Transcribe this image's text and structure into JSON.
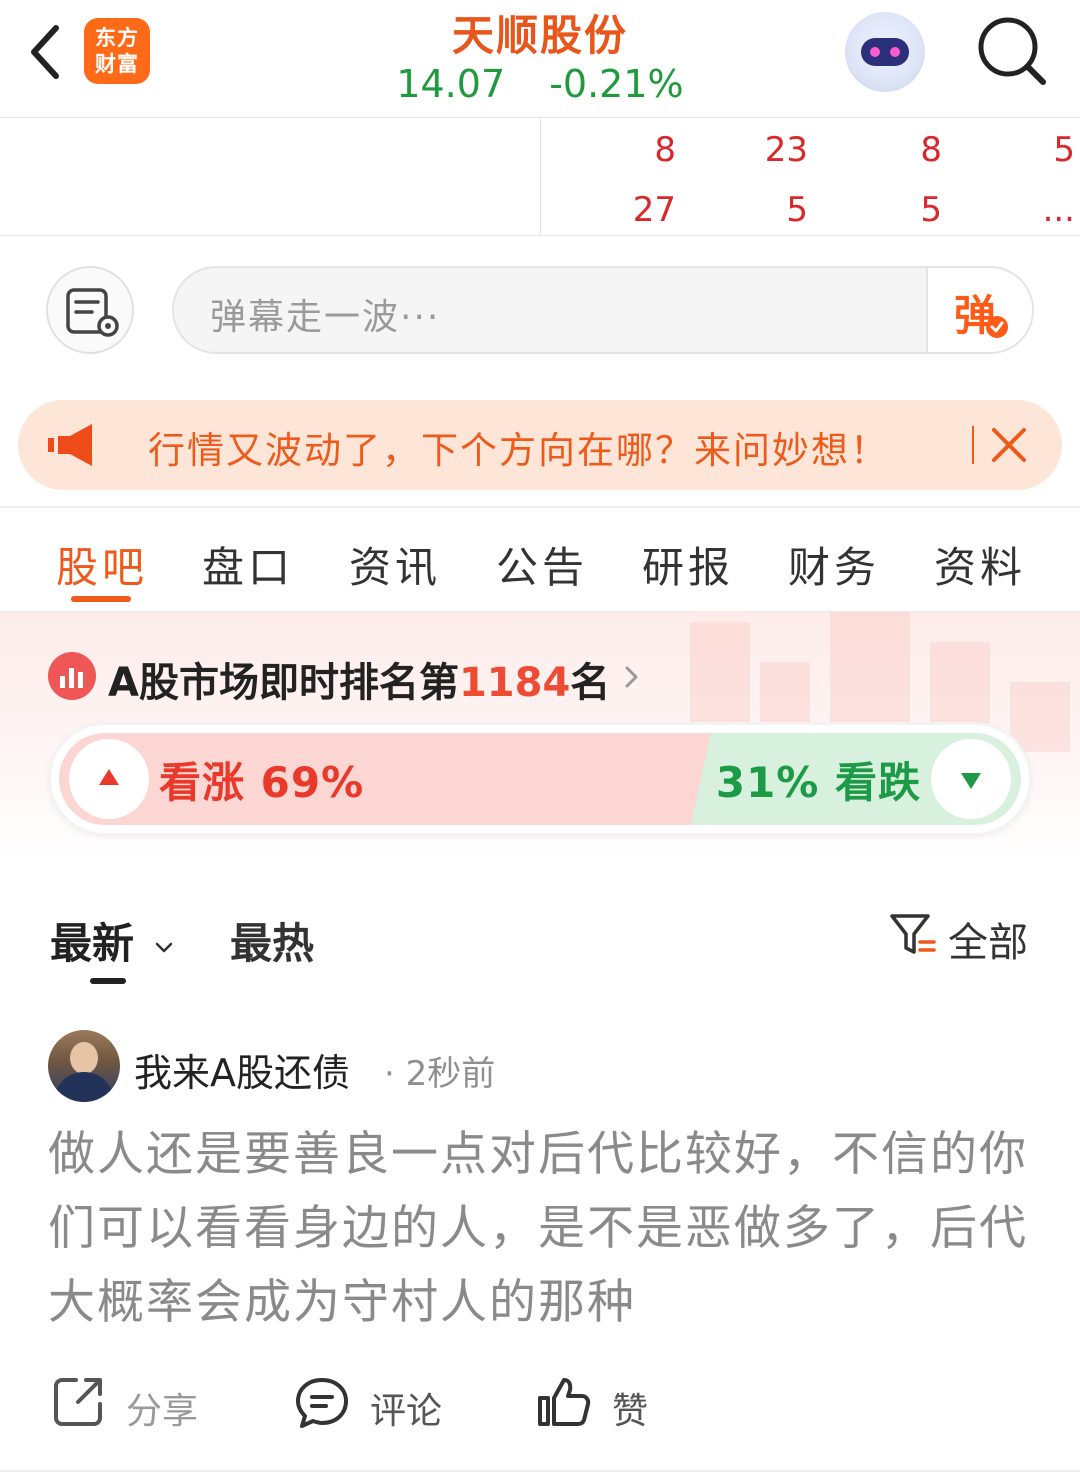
{
  "header": {
    "logo_line1": "东方",
    "logo_line2": "财富",
    "stock_name": "天顺股份",
    "price": "14.07",
    "change": "-0.21%"
  },
  "ticker": {
    "row1": [
      "8",
      "23",
      "8",
      "5"
    ],
    "row2": [
      "27",
      "5",
      "5",
      "..."
    ]
  },
  "danmu": {
    "placeholder": "弹幕走一波···",
    "button": "弹"
  },
  "promo": {
    "text": "行情又波动了，下个方向在哪？来问妙想！"
  },
  "tabs": [
    "股吧",
    "盘口",
    "资讯",
    "公告",
    "研报",
    "财务",
    "资料"
  ],
  "ranking": {
    "prefix": "A股市场即时排名第",
    "rank": "1184",
    "suffix": "名"
  },
  "vote": {
    "up_label": "看涨 69%",
    "down_label": "31% 看跌",
    "up_percent": 69,
    "down_percent": 31
  },
  "feed": {
    "tab_latest": "最新",
    "tab_hot": "最热",
    "filter": "全部"
  },
  "post": {
    "author": "我来A股还债",
    "time": "· 2秒前",
    "content": "做人还是要善良一点对后代比较好，不信的你们可以看看身边的人，是不是恶做多了，后代大概率会成为守村人的那种",
    "share": "分享",
    "comment": "评论",
    "like": "赞"
  },
  "colors": {
    "brand_orange": "#ee5a1b",
    "price_green": "#1f9a3c",
    "up_red": "#e8392b",
    "down_green": "#1c9a45"
  }
}
